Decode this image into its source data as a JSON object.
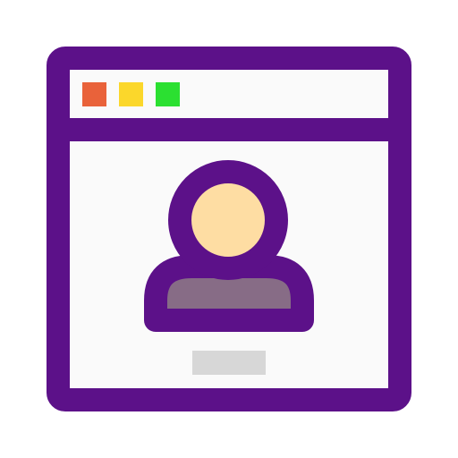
{
  "icon": {
    "name": "user-profile-window-icon",
    "colors": {
      "outline": "#5c1189",
      "window_background": "#fafafa",
      "dot_close": "#e9623a",
      "dot_minimize": "#fbd72b",
      "dot_maximize": "#2be031",
      "avatar_head": "#fedda3",
      "avatar_body": "#876c86",
      "name_placeholder": "#d7d7d7"
    }
  }
}
